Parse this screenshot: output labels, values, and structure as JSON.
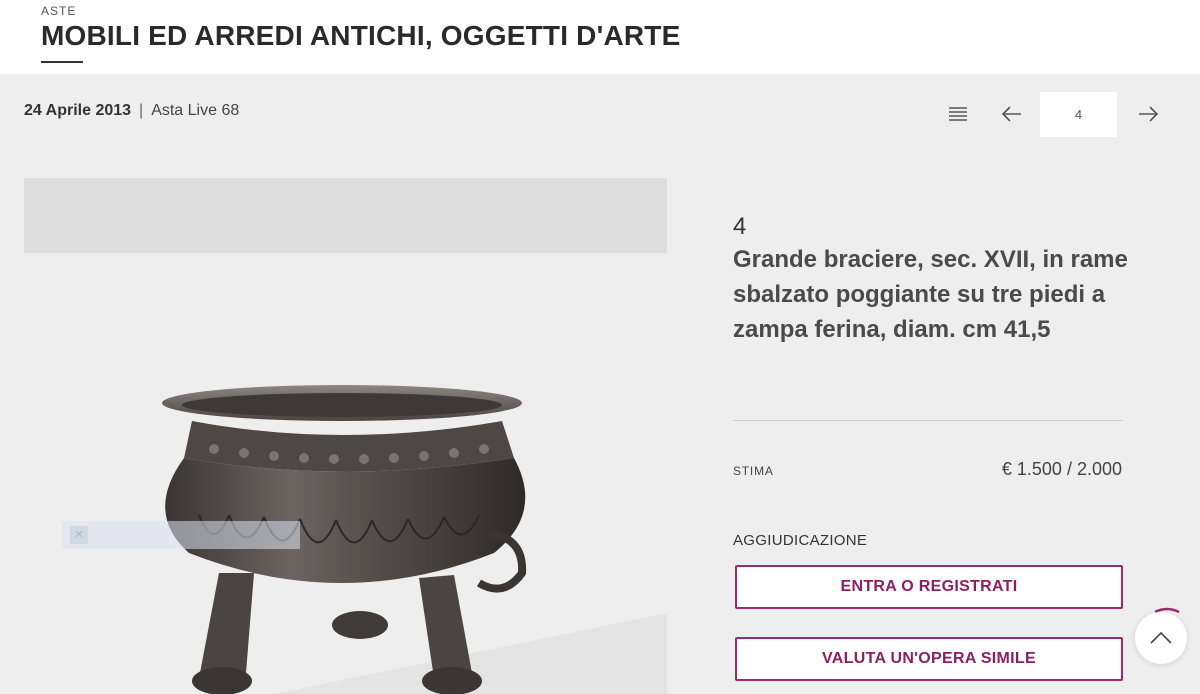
{
  "header": {
    "kicker": "ASTE",
    "title": "MOBILI ED ARREDI ANTICHI, OGGETTI D'ARTE"
  },
  "auction_meta": {
    "date": "24 Aprile 2013",
    "separator": "|",
    "event": "Asta Live 68"
  },
  "pagination": {
    "current_page": "4",
    "list_icon": "list-icon",
    "prev_icon": "arrow-left-icon",
    "next_icon": "arrow-right-icon"
  },
  "lot": {
    "number": "4",
    "title": "Grande braciere, sec. XVII, in rame sbalzato poggiante su tre piedi a zampa ferina, diam. cm 41,5",
    "estimate_label": "STIMA",
    "estimate_value": "€ 1.500 / 2.000",
    "award_label": "AGGIUDICAZIONE"
  },
  "buttons": {
    "register": "ENTRA O REGISTRATI",
    "valuate": "VALUTA UN'OPERA SIMILE"
  },
  "colors": {
    "accent": "#9b2c6f",
    "background": "#eeeeee",
    "bronze": "#4a4442"
  }
}
